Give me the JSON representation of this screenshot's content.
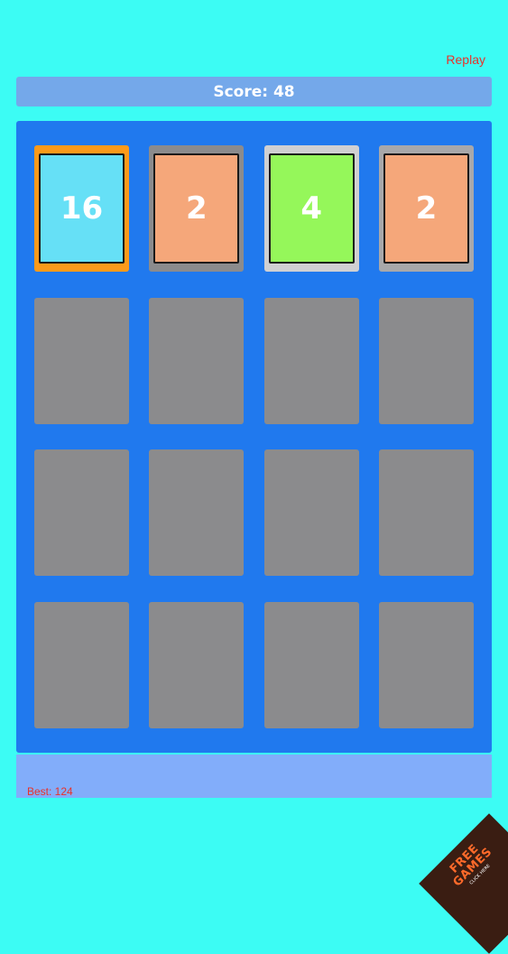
{
  "header": {
    "replay_label": "Replay",
    "score_label": "Score: 48"
  },
  "board": {
    "rows": 4,
    "cols": 4,
    "tiles": [
      {
        "row": 0,
        "col": 0,
        "value": "16",
        "frame_color": "#fb9a1a",
        "fill_color": "#66e0f6"
      },
      {
        "row": 0,
        "col": 1,
        "value": "2",
        "frame_color": "#8b8b8d",
        "fill_color": "#f5a77a"
      },
      {
        "row": 0,
        "col": 2,
        "value": "4",
        "frame_color": "#d0d0d2",
        "fill_color": "#95f75a"
      },
      {
        "row": 0,
        "col": 3,
        "value": "2",
        "frame_color": "#a8a8aa",
        "fill_color": "#f5a77a"
      }
    ],
    "empty_cell_color": "#8b8b8d",
    "board_color": "#2079ee"
  },
  "footer": {
    "best_label": "Best: 124"
  },
  "badge": {
    "line1": "FREE",
    "line2": "GAMES",
    "sub": "CLICK HERE"
  },
  "colors": {
    "background": "#3cfcf4",
    "score_bar": "#74a8ea",
    "footer_bar": "#82adfa",
    "accent_text": "#e8322a"
  }
}
